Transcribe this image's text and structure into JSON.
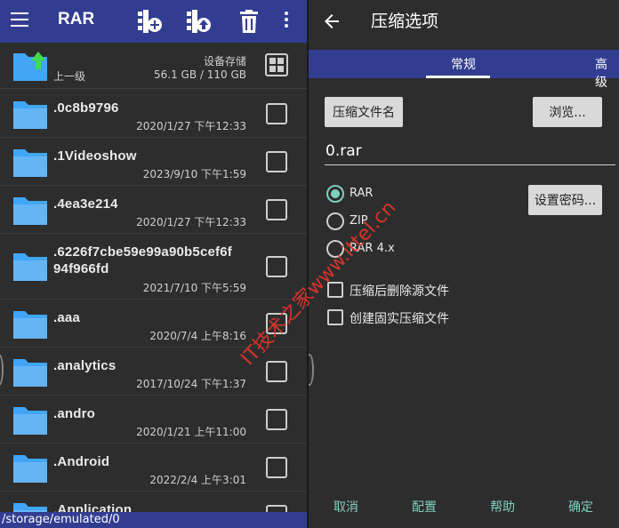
{
  "left": {
    "title": "RAR",
    "up_label": "上一级",
    "storage_label": "设备存储",
    "storage_size": "56.1 GB / 110 GB",
    "files": [
      {
        "name": ".0c8b9796",
        "date": "2020/1/27 下午12:33"
      },
      {
        "name": ".1Videoshow",
        "date": "2023/9/10 下午1:59"
      },
      {
        "name": ".4ea3e214",
        "date": "2020/1/27 下午12:33"
      },
      {
        "name": ".6226f7cbe59e99a90b5cef6f",
        "name2": "94f966fd",
        "date": "2021/7/10 下午5:59"
      },
      {
        "name": ".aaa",
        "date": "2020/7/4 上午8:16"
      },
      {
        "name": ".analytics",
        "date": "2017/10/24 下午1:37"
      },
      {
        "name": ".andro",
        "date": "2020/1/21 上午11:00"
      },
      {
        "name": ".Android",
        "date": "2022/2/4 上午3:01"
      },
      {
        "name": ".Application",
        "date": ""
      }
    ],
    "path": "/storage/emulated/0"
  },
  "right": {
    "title": "压缩选项",
    "tabs": [
      "常规",
      "高级"
    ],
    "archive_name_button": "压缩文件名",
    "browse_button": "浏览...",
    "filename_value": "0.rar",
    "formats": [
      "RAR",
      "ZIP",
      "RAR 4.x"
    ],
    "selected_format": "RAR",
    "set_password_button": "设置密码...",
    "options": [
      "压缩后删除源文件",
      "创建固实压缩文件"
    ],
    "footer": [
      "取消",
      "配置",
      "帮助",
      "确定"
    ]
  },
  "watermark": "IT技术之家www.ittel.cn",
  "colors": {
    "bar": "#323d92",
    "accent": "#7fcfbf",
    "folder": "#42a5f5",
    "watermark": "#e0352b"
  }
}
